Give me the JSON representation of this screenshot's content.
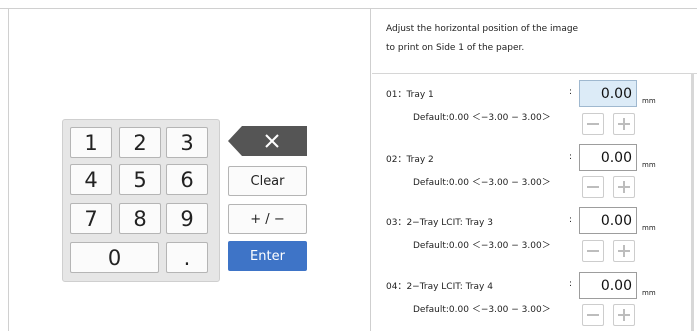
{
  "keypad": {
    "keys": [
      "1",
      "2",
      "3",
      "4",
      "5",
      "6",
      "7",
      "8",
      "9",
      "0",
      "."
    ],
    "clear_label": "Clear",
    "plusminus_label": "+ / −",
    "enter_label": "Enter",
    "backspace_icon": "backspace-icon"
  },
  "panel": {
    "description_line1": "Adjust the horizontal position of the image",
    "description_line2": "to print on Side 1 of the paper.",
    "colon": ":",
    "rows": [
      {
        "label": "01：Tray 1",
        "default": "Default:0.00 ＜−3.00 − 3.00＞",
        "value": "0.00",
        "unit": "mm"
      },
      {
        "label": "02：Tray 2",
        "default": "Default:0.00 ＜−3.00 − 3.00＞",
        "value": "0.00",
        "unit": "mm"
      },
      {
        "label": "03：2−Tray LCIT: Tray 3",
        "default": "Default:0.00 ＜−3.00 − 3.00＞",
        "value": "0.00",
        "unit": "mm"
      },
      {
        "label": "04：2−Tray LCIT: Tray 4",
        "default": "Default:0.00 ＜−3.00 − 3.00＞",
        "value": "0.00",
        "unit": "mm"
      }
    ]
  },
  "colors": {
    "accent": "#3e74c7",
    "active_field": "#dcebf7"
  }
}
